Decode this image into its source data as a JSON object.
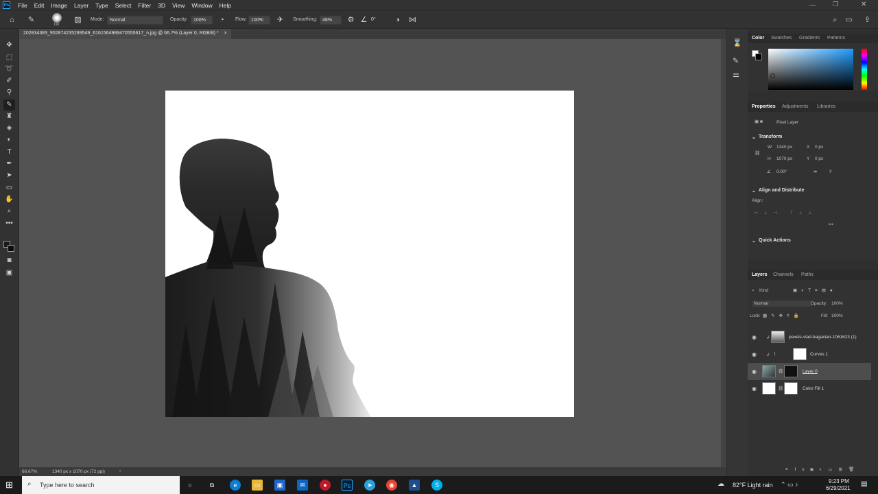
{
  "menubar": {
    "logo": "Ps",
    "items": [
      "File",
      "Edit",
      "Image",
      "Layer",
      "Type",
      "Select",
      "Filter",
      "3D",
      "View",
      "Window",
      "Help"
    ]
  },
  "options": {
    "brush_size": "190",
    "mode_label": "Mode:",
    "mode_value": "Normal",
    "opacity_label": "Opacity:",
    "opacity_value": "100%",
    "flow_label": "Flow:",
    "flow_value": "100%",
    "smoothing_label": "Smoothing:",
    "smoothing_value": "48%",
    "angle_value": "0°"
  },
  "document": {
    "tab_title": "202834383_952874235289549_6161564989470555617_n.jpg @ 66.7% (Layer 0, RGB/8) *",
    "close": "×"
  },
  "status": {
    "zoom": "66.67%",
    "size": "1340 px x 1070 px (72 ppi)",
    "arrow": "›"
  },
  "color_panel": {
    "tabs": [
      "Color",
      "Swatches",
      "Gradients",
      "Patterns"
    ],
    "accent": "#1e9bff"
  },
  "properties": {
    "tabs": [
      "Properties",
      "Adjustments",
      "Libraries"
    ],
    "layer_type": "Pixel Layer",
    "transform_title": "Transform",
    "w_label": "W",
    "w_value": "1340 px",
    "h_label": "H",
    "h_value": "1070 px",
    "x_label": "X",
    "x_value": "0 px",
    "y_label": "Y",
    "y_value": "0 px",
    "angle_value": "0.00°",
    "align_title": "Align and Distribute",
    "align_label": "Align:",
    "more": "•••",
    "quick_actions_title": "Quick Actions"
  },
  "layers_panel": {
    "tabs": [
      "Layers",
      "Channels",
      "Paths"
    ],
    "filter_label": "Kind",
    "blend_mode": "Normal",
    "opacity_label": "Opacity:",
    "opacity_value": "100%",
    "lock_label": "Lock:",
    "fill_label": "Fill:",
    "fill_value": "100%",
    "layers": [
      {
        "name": "pexels-vlad-bagacian-1061623 (1)"
      },
      {
        "name": "Curves 1"
      },
      {
        "name": "Layer 0"
      },
      {
        "name": "Color Fill 1"
      }
    ]
  },
  "taskbar": {
    "search_placeholder": "Type here to search",
    "weather": "82°F  Light rain",
    "time": "9:23 PM",
    "date": "6/29/2021"
  }
}
